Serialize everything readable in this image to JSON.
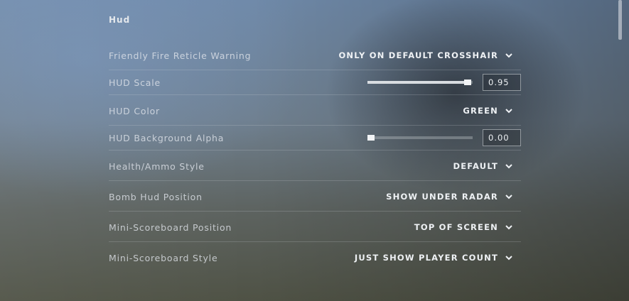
{
  "section": {
    "title": "Hud"
  },
  "rows": [
    {
      "label": "Friendly Fire Reticle Warning",
      "type": "dropdown",
      "value": "ONLY ON DEFAULT CROSSHAIR"
    },
    {
      "label": "HUD Scale",
      "type": "slider",
      "value": "0.95",
      "level": 0.95
    },
    {
      "label": "HUD Color",
      "type": "dropdown",
      "value": "GREEN"
    },
    {
      "label": "HUD Background Alpha",
      "type": "slider",
      "value": "0.00",
      "level": 0.0
    },
    {
      "label": "Health/Ammo Style",
      "type": "dropdown",
      "value": "DEFAULT"
    },
    {
      "label": "Bomb Hud Position",
      "type": "dropdown",
      "value": "SHOW UNDER RADAR"
    },
    {
      "label": "Mini-Scoreboard Position",
      "type": "dropdown",
      "value": "TOP OF SCREEN"
    },
    {
      "label": "Mini-Scoreboard Style",
      "type": "dropdown",
      "value": "JUST SHOW PLAYER COUNT"
    }
  ],
  "icons": {
    "dropdown": "chevron-down-icon"
  }
}
